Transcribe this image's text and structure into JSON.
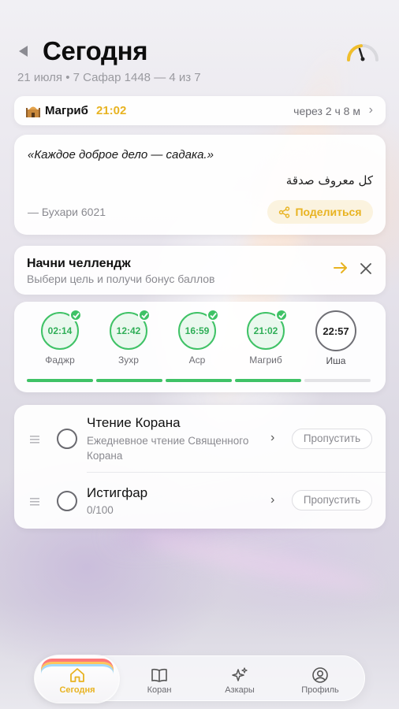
{
  "header": {
    "title": "Сегодня",
    "subtitle": "21 июля • 7 Сафар 1448 — 4 из 7"
  },
  "next_prayer": {
    "name": "Магриб",
    "time": "21:02",
    "remaining": "через 2 ч 8 м",
    "icon": "mosque-icon"
  },
  "quote": {
    "text": "«Каждое доброе дело — садака.»",
    "arabic": "كل معروف صدقة",
    "source": "— Бухари 6021",
    "share_label": "Поделиться"
  },
  "challenge": {
    "title": "Начни челлендж",
    "subtitle": "Выбери цель и получи бонус баллов"
  },
  "prayers": [
    {
      "time": "02:14",
      "name": "Фаджр",
      "done": true
    },
    {
      "time": "12:42",
      "name": "Зухр",
      "done": true
    },
    {
      "time": "16:59",
      "name": "Аср",
      "done": true
    },
    {
      "time": "21:02",
      "name": "Магриб",
      "done": true
    },
    {
      "time": "22:57",
      "name": "Иша",
      "done": false
    }
  ],
  "tasks": [
    {
      "title": "Чтение Корана",
      "subtitle": "Ежедневное чтение Священного Корана",
      "skip_label": "Пропустить"
    },
    {
      "title": "Истигфар",
      "subtitle": "0/100",
      "skip_label": "Пропустить"
    }
  ],
  "tabs": [
    {
      "label": "Сегодня",
      "icon": "home-icon",
      "active": true
    },
    {
      "label": "Коран",
      "icon": "book-icon",
      "active": false
    },
    {
      "label": "Азкары",
      "icon": "sparkles-icon",
      "active": false
    },
    {
      "label": "Профиль",
      "icon": "profile-icon",
      "active": false
    }
  ],
  "colors": {
    "accent": "#e8b321",
    "done_green": "#3fc266"
  }
}
